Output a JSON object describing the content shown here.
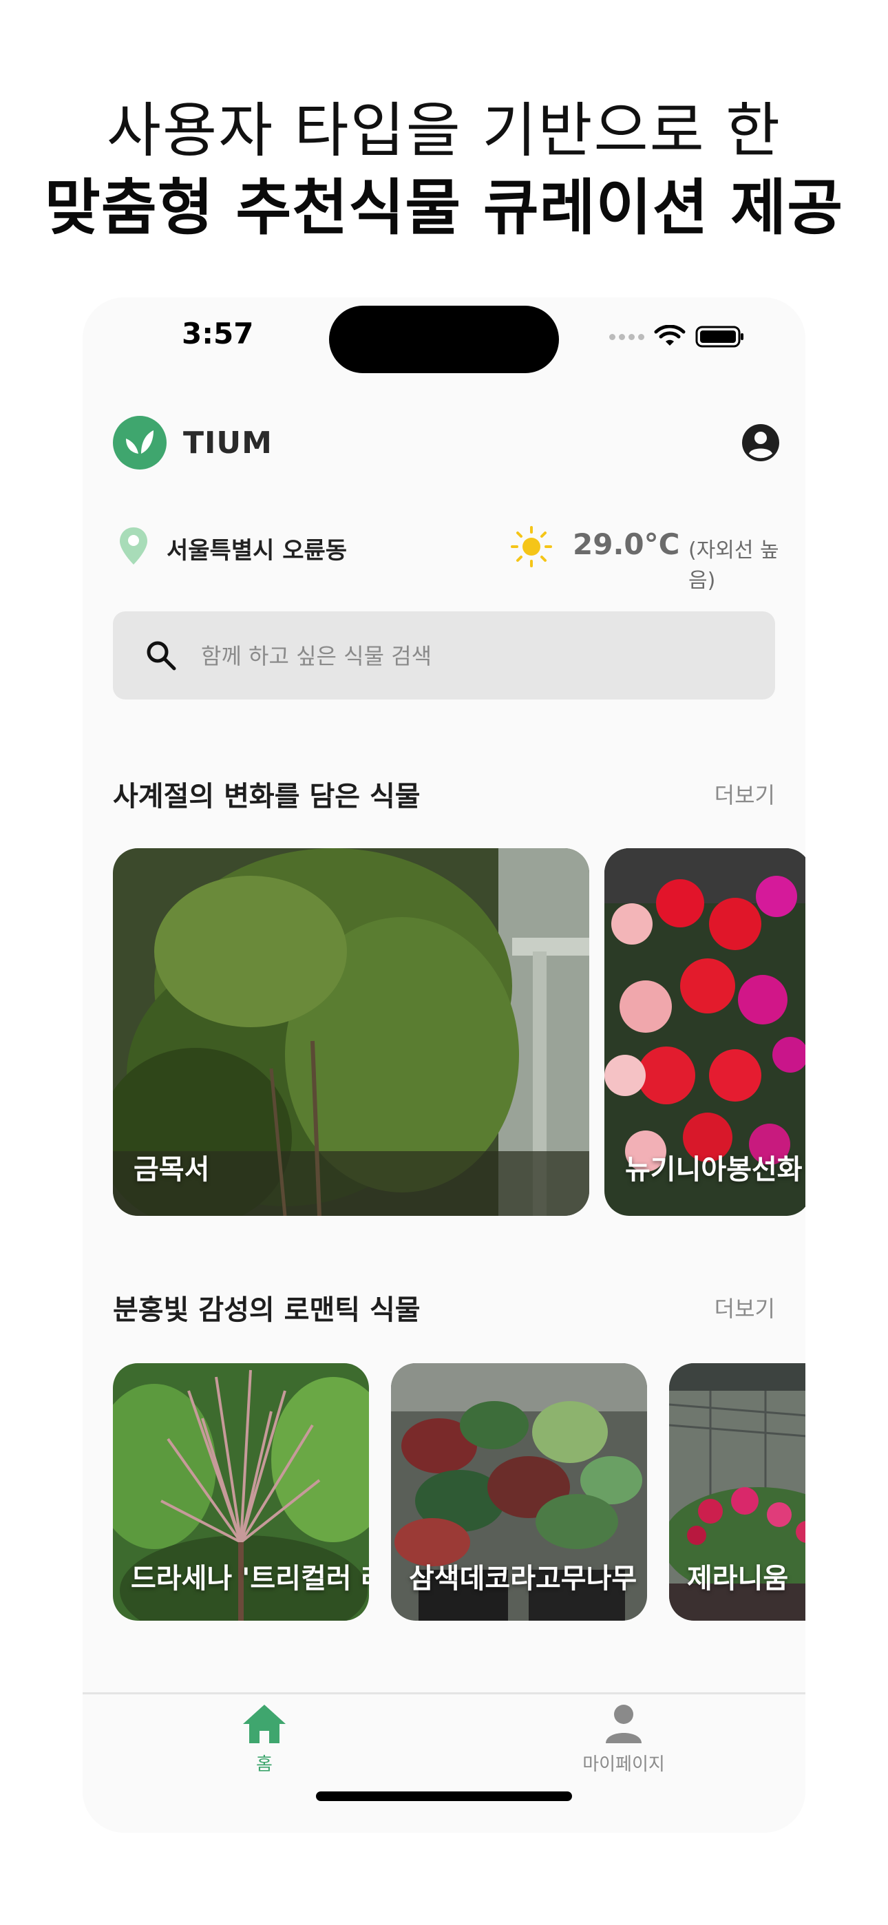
{
  "headline": {
    "line1": "사용자 타입을 기반으로 한",
    "line2": "맞춤형 추천식물 큐레이션 제공"
  },
  "status_bar": {
    "time": "3:57"
  },
  "app": {
    "title": "TIUM"
  },
  "location": {
    "place": "서울특별시 오륜동",
    "temperature": "29.0°C",
    "uv_note": "(자외선 높음)"
  },
  "search": {
    "placeholder": "함께 하고 싶은 식물 검색",
    "value": ""
  },
  "sections": [
    {
      "title": "사계절의 변화를 담은 식물",
      "more": "더보기",
      "cards": [
        {
          "label": "금목서"
        },
        {
          "label": "뉴기니아봉선화"
        }
      ]
    },
    {
      "title": "분홍빛 감성의 로맨틱 식물",
      "more": "더보기",
      "cards": [
        {
          "label": "드라세나 '트리컬러 레인보우'"
        },
        {
          "label": "삼색데코라고무나무"
        },
        {
          "label": "제라니움"
        }
      ]
    }
  ],
  "tabs": [
    {
      "label": "홈",
      "icon": "home-icon",
      "active": true
    },
    {
      "label": "마이페이지",
      "icon": "person-icon",
      "active": false
    }
  ],
  "colors": {
    "brand": "#3fa66e",
    "background": "#fafafa",
    "search_bg": "#e6e6e6",
    "muted_text": "#8a8a8a"
  }
}
